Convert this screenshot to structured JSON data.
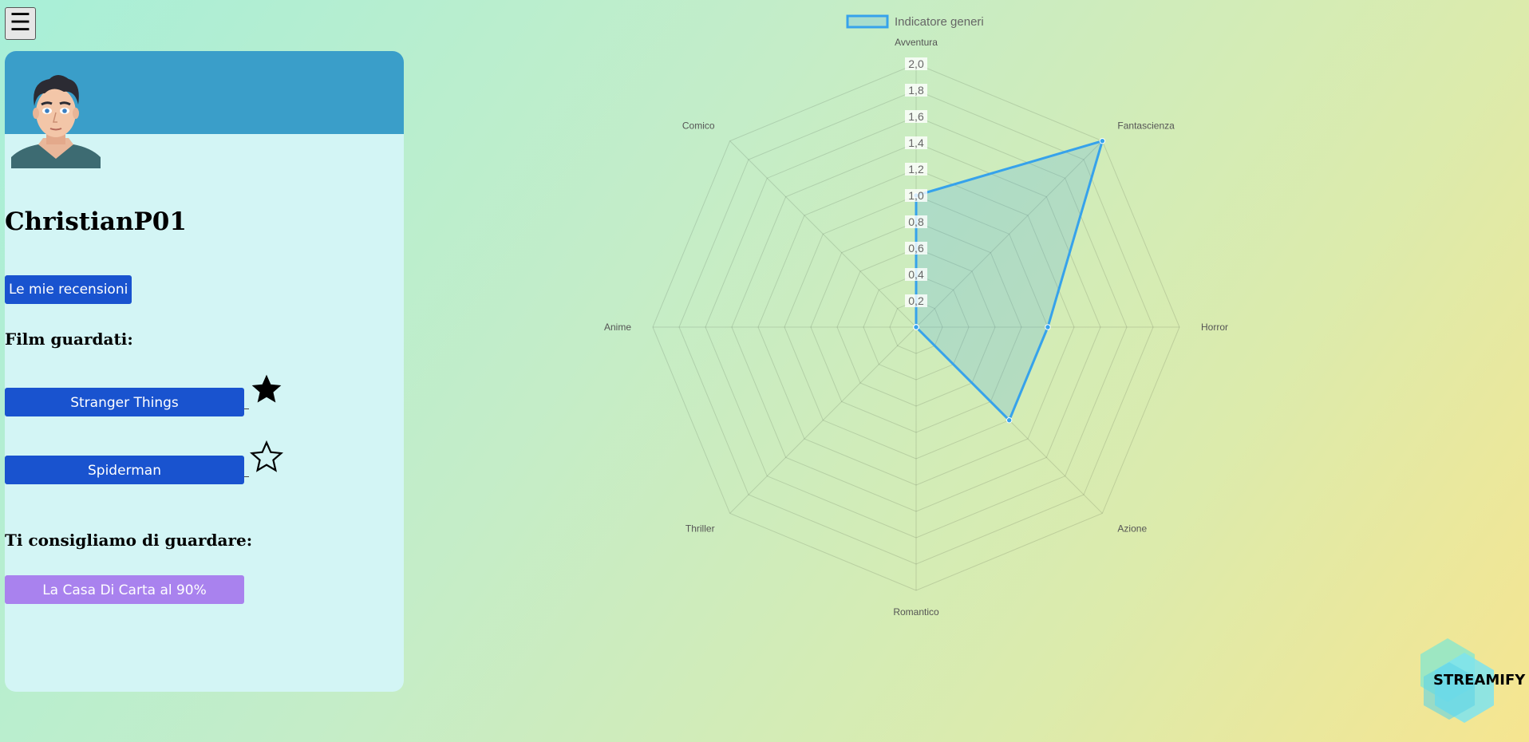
{
  "menu": {
    "icon": "hamburger-menu-icon",
    "glyph": "☰"
  },
  "profile": {
    "avatar_icon": "user-avatar",
    "username": "ChristianP01",
    "reviews_button": "Le mie recensioni"
  },
  "watched": {
    "title": "Film guardati:",
    "items": [
      {
        "name": "Stranger Things",
        "favorite": true
      },
      {
        "name": "Spiderman",
        "favorite": false
      }
    ]
  },
  "recommend": {
    "title": "Ti consigliamo di guardare:",
    "item": "La Casa Di Carta al 90%"
  },
  "colors": {
    "card_bg": "#d3f5f5",
    "card_header": "#3a9ec9",
    "primary_button": "#1953cf",
    "recommend_button": "#a982ee",
    "chart_line": "#36a2eb",
    "chart_fill": "rgba(54,162,235,0.2)"
  },
  "chart_data": {
    "type": "radar",
    "legend_position": "top",
    "series": [
      {
        "name": "Indicatore generi",
        "values": [
          1.0,
          2.0,
          1.0,
          1.0,
          0,
          0,
          0,
          0
        ]
      }
    ],
    "categories": [
      "Avventura",
      "Fantascienza",
      "Horror",
      "Azione",
      "Romantico",
      "Thriller",
      "Anime",
      "Comico"
    ],
    "r_min": 0,
    "r_max": 2.0,
    "tick_step": 0.2,
    "tick_labels": [
      "0,2",
      "0,4",
      "0,6",
      "0,8",
      "1,0",
      "1,2",
      "1,4",
      "1,6",
      "1,8",
      "2,0"
    ]
  },
  "logo": {
    "text": "STREAMIFY"
  }
}
